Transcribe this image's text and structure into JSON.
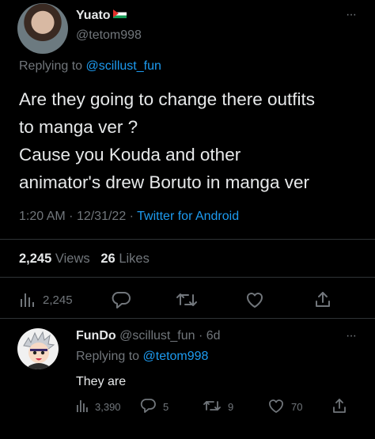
{
  "tweet": {
    "author_name": "Yuato",
    "author_handle": "@tetom998",
    "replying_prefix": "Replying to",
    "replying_to": "@scillust_fun",
    "lines": [
      "Are they going to change there outfits",
      "to manga ver ?",
      "Cause you Kouda and other",
      "animator's drew Boruto in manga ver"
    ],
    "time": "1:20 AM",
    "date": "12/31/22",
    "source": "Twitter for Android",
    "views_count": "2,245",
    "views_label": "Views",
    "likes_count": "26",
    "likes_label": "Likes",
    "analytics_count": "2,245",
    "more_glyph": "···"
  },
  "reply": {
    "author_name": "FunDo",
    "author_handle": "@scillust_fun",
    "age": "6d",
    "replying_prefix": "Replying to",
    "replying_to": "@tetom998",
    "text": "They are",
    "analytics_count": "3,390",
    "reply_count": "5",
    "retweet_count": "9",
    "like_count": "70",
    "more_glyph": "···"
  },
  "colors": {
    "background": "#000000",
    "text_primary": "#e7e9ea",
    "text_secondary": "#71767b",
    "accent": "#1d9bf0",
    "divider": "#2f3336"
  },
  "icons": [
    "analytics-icon",
    "reply-icon",
    "retweet-icon",
    "like-icon",
    "share-icon",
    "more-icon",
    "palestine-flag-icon"
  ]
}
